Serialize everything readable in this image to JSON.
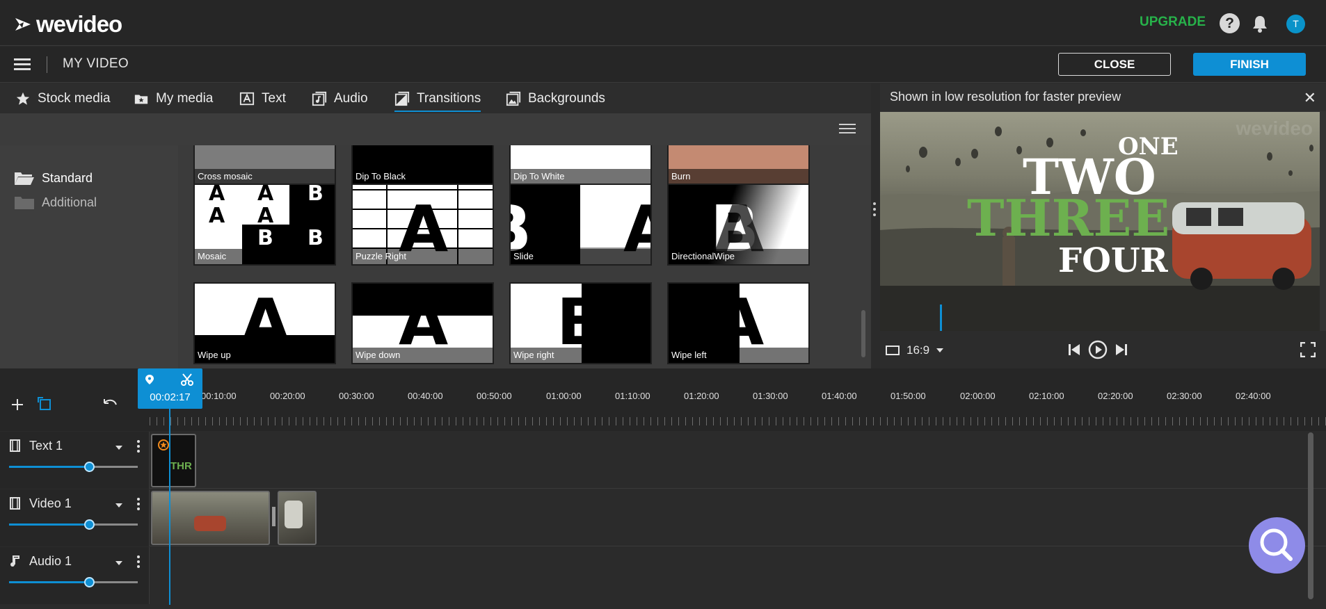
{
  "app": {
    "brand": "wevideo",
    "upgrade_label": "UPGRADE",
    "avatar_initial": "T"
  },
  "project": {
    "title": "MY VIDEO",
    "close_label": "CLOSE",
    "finish_label": "FINISH"
  },
  "tabs": [
    {
      "label": "Stock media",
      "icon": "star-icon"
    },
    {
      "label": "My media",
      "icon": "my-media-icon"
    },
    {
      "label": "Text",
      "icon": "text-icon"
    },
    {
      "label": "Audio",
      "icon": "audio-icon"
    },
    {
      "label": "Transitions",
      "icon": "transitions-icon",
      "active": true
    },
    {
      "label": "Backgrounds",
      "icon": "backgrounds-icon"
    }
  ],
  "categories": [
    {
      "label": "Standard",
      "selected": true
    },
    {
      "label": "Additional",
      "selected": false
    }
  ],
  "transitions_top_row": [
    "Cross mosaic",
    "Dip To Black",
    "Dip To White",
    "Burn"
  ],
  "transitions": [
    {
      "label": "Mosaic"
    },
    {
      "label": "Puzzle Right"
    },
    {
      "label": "Slide"
    },
    {
      "label": "DirectionalWipe"
    },
    {
      "label": "Wipe up"
    },
    {
      "label": "Wipe down"
    },
    {
      "label": "Wipe right"
    },
    {
      "label": "Wipe left"
    }
  ],
  "thumb_letters": {
    "a": "A",
    "b": "B"
  },
  "preview": {
    "note": "Shown in low resolution for faster preview",
    "close_glyph": "✕",
    "watermark": "wevideo",
    "frame_words": [
      "ONE",
      "TWO",
      "THREE",
      "FOUR"
    ],
    "aspect_ratio": "16:9",
    "accent_green": "#6db04f"
  },
  "timeline": {
    "playhead_time": "00:02:17",
    "ruler_labels": [
      "00:10:00",
      "00:20:00",
      "00:30:00",
      "00:40:00",
      "00:50:00",
      "01:00:00",
      "01:10:00",
      "01:20:00",
      "01:30:00",
      "01:40:00",
      "01:50:00",
      "02:00:00",
      "02:10:00",
      "02:20:00",
      "02:30:00",
      "02:40:00"
    ],
    "tracks": [
      {
        "name": "Text 1",
        "type": "text",
        "volume": 0.62
      },
      {
        "name": "Video 1",
        "type": "video",
        "volume": 0.62
      },
      {
        "name": "Audio 1",
        "type": "audio",
        "volume": 0.62
      }
    ]
  },
  "colors": {
    "accent": "#0e8fd4",
    "upgrade": "#27b24a",
    "fab": "#8e8be8"
  }
}
